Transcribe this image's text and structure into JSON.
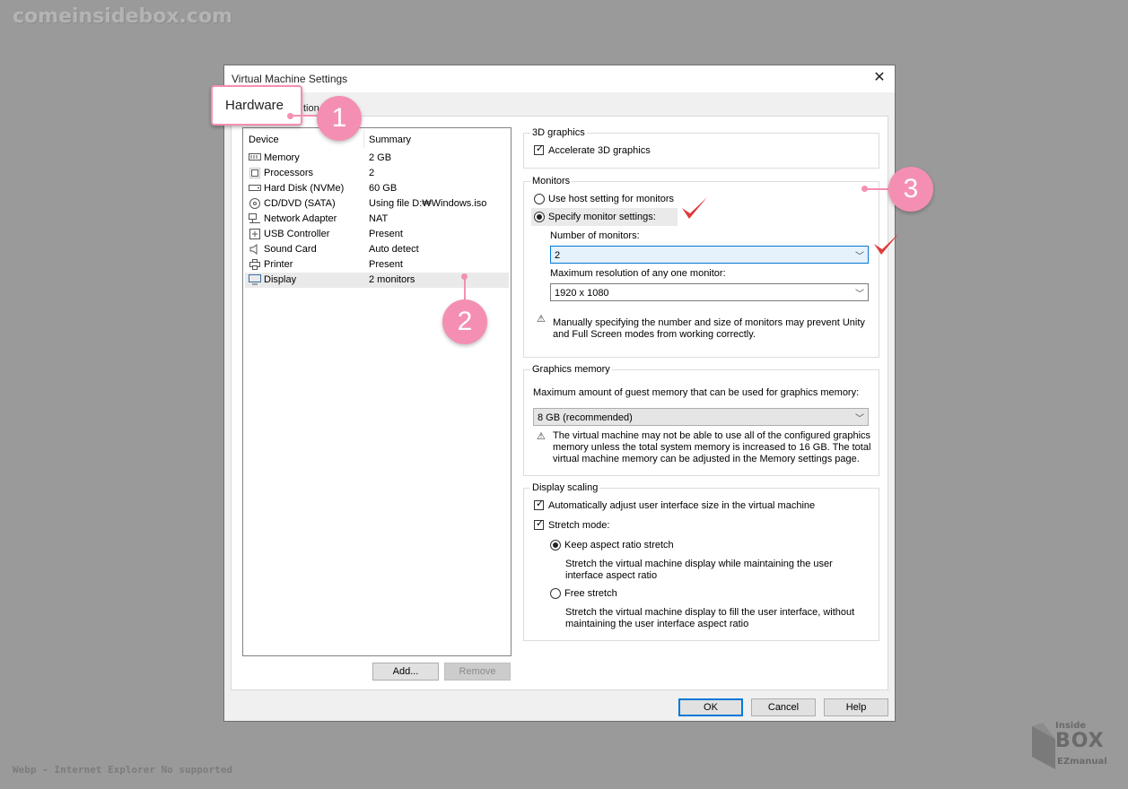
{
  "watermark": {
    "site": "comeinsidebox.com",
    "footer": "Webp - Internet Explorer No supported",
    "logo_top": "Inside",
    "logo_main": "BOX",
    "logo_bottom": "EZmanual"
  },
  "window": {
    "title": "Virtual Machine Settings",
    "close_symbol": "✕"
  },
  "tabs": {
    "hardware": "Hardware",
    "options_partial": "tion"
  },
  "device_list": {
    "header": {
      "device": "Device",
      "summary": "Summary"
    },
    "rows": [
      {
        "icon": "memory-icon",
        "name": "Memory",
        "summary": "2 GB"
      },
      {
        "icon": "processor-icon",
        "name": "Processors",
        "summary": "2"
      },
      {
        "icon": "hard-disk-icon",
        "name": "Hard Disk (NVMe)",
        "summary": "60 GB"
      },
      {
        "icon": "cd-dvd-icon",
        "name": "CD/DVD (SATA)",
        "summary": "Using file D:₩Windows.iso"
      },
      {
        "icon": "network-icon",
        "name": "Network Adapter",
        "summary": "NAT"
      },
      {
        "icon": "usb-icon",
        "name": "USB Controller",
        "summary": "Present"
      },
      {
        "icon": "sound-icon",
        "name": "Sound Card",
        "summary": "Auto detect"
      },
      {
        "icon": "printer-icon",
        "name": "Printer",
        "summary": "Present"
      },
      {
        "icon": "display-icon",
        "name": "Display",
        "summary": "2 monitors",
        "selected": true
      }
    ],
    "add_button": "Add...",
    "remove_button": "Remove"
  },
  "graphics3d": {
    "legend": "3D graphics",
    "accelerate_label": "Accelerate 3D graphics",
    "accelerate_checked": true
  },
  "monitors": {
    "legend": "Monitors",
    "use_host_label": "Use host setting for monitors",
    "specify_label": "Specify monitor settings:",
    "number_label": "Number of monitors:",
    "number_value": "2",
    "max_res_label": "Maximum resolution of any one monitor:",
    "max_res_value": "1920 x 1080",
    "warning_line1": "Manually specifying the number and size of monitors may prevent Unity",
    "warning_line2": "and Full Screen modes from working correctly."
  },
  "graphics_memory": {
    "legend": "Graphics memory",
    "label": "Maximum amount of guest memory that can be used for graphics memory:",
    "value": "8 GB (recommended)",
    "warning_line1": "The virtual machine may not be able to use all of the configured graphics",
    "warning_line2": "memory unless the total system memory is increased to 16 GB. The total",
    "warning_line3": "virtual machine memory can be adjusted in the Memory settings page."
  },
  "display_scaling": {
    "legend": "Display scaling",
    "auto_adjust_label": "Automatically adjust user interface size in the virtual machine",
    "stretch_label": "Stretch mode:",
    "keep_aspect_label": "Keep aspect ratio stretch",
    "keep_aspect_desc1": "Stretch the virtual machine display while maintaining the user",
    "keep_aspect_desc2": "interface aspect ratio",
    "free_label": "Free stretch",
    "free_desc1": "Stretch the virtual machine display to fill the user interface, without",
    "free_desc2": "maintaining the user interface aspect ratio"
  },
  "footer_buttons": {
    "ok": "OK",
    "cancel": "Cancel",
    "help": "Help"
  },
  "callouts": {
    "one": "1",
    "two": "2",
    "three": "3"
  },
  "colors": {
    "callout": "#f48fb3",
    "check": "#e03a3a",
    "focus": "#0078d7"
  }
}
